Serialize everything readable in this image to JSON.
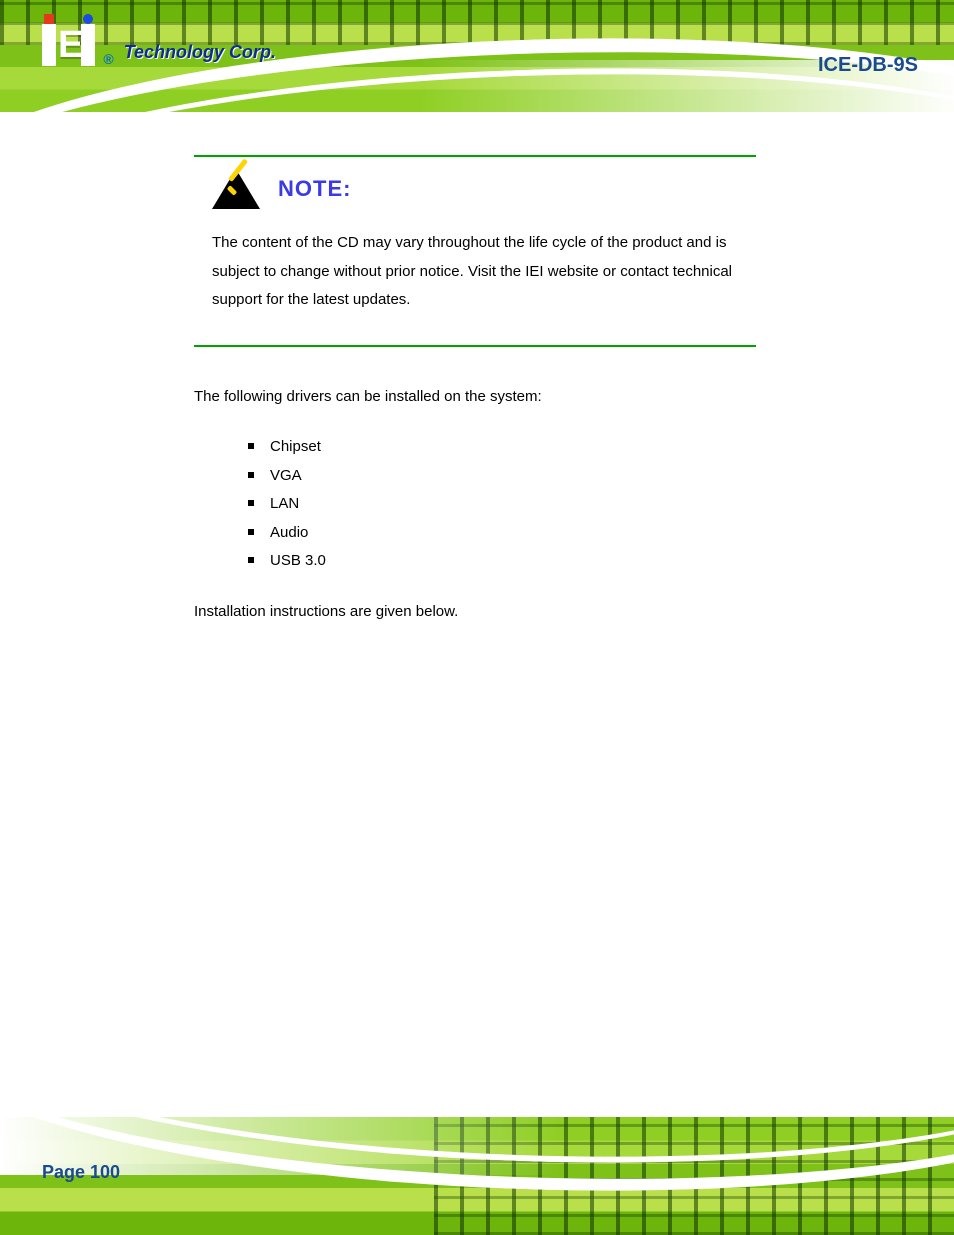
{
  "brand": {
    "logo_text": "iEi",
    "registered": "®",
    "tech_corp": "Technology Corp."
  },
  "product_label": "ICE-DB-9S",
  "note": {
    "title": "NOTE:",
    "body": "The content of the CD may vary throughout the life cycle of the product and is subject to change without prior notice. Visit the IEI website or contact technical support for the latest updates."
  },
  "intro_para": "The following drivers can be installed on the system:",
  "drivers": [
    "Chipset",
    "VGA",
    "LAN",
    "Audio",
    "USB 3.0"
  ],
  "outro_para": "Installation instructions are given below.",
  "page_label": "Page 100"
}
